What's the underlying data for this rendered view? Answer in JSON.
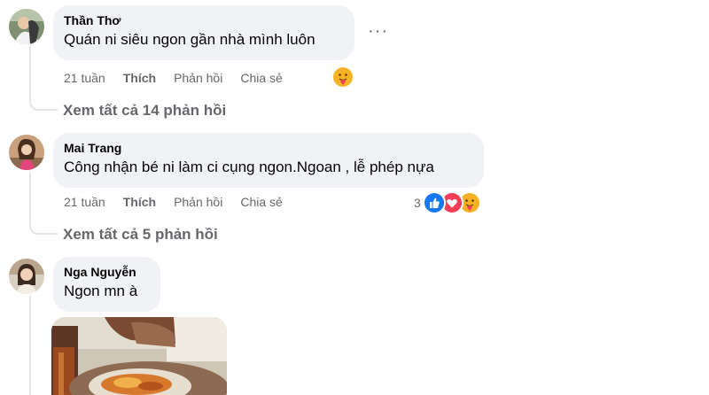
{
  "comments": [
    {
      "author": "Thần Thơ",
      "text": "Quán ni siêu ngon gần nhà mình luôn",
      "time": "21 tuần",
      "like_label": "Thích",
      "reply_label": "Phản hồi",
      "share_label": "Chia sẻ",
      "view_replies": "Xem tất cả 14 phản hồi",
      "reactions": [
        "care"
      ]
    },
    {
      "author": "Mai Trang",
      "text": "Công nhận bé ni làm ci cụng ngon.Ngoan , lễ phép nựa",
      "time": "21 tuần",
      "like_label": "Thích",
      "reply_label": "Phản hồi",
      "share_label": "Chia sẻ",
      "reaction_count": "3",
      "view_replies": "Xem tất cả 5 phản hồi",
      "reactions": [
        "like",
        "love",
        "care"
      ]
    },
    {
      "author": "Nga Nguyễn",
      "text": "Ngon mn à",
      "reactions": []
    }
  ],
  "more_options": "···",
  "colors": {
    "bubble": "#f0f2f5",
    "secondary_text": "#65676b",
    "like_blue": "#1877f2",
    "love_red": "#f33e58",
    "care_yellow": "#f7b125"
  }
}
